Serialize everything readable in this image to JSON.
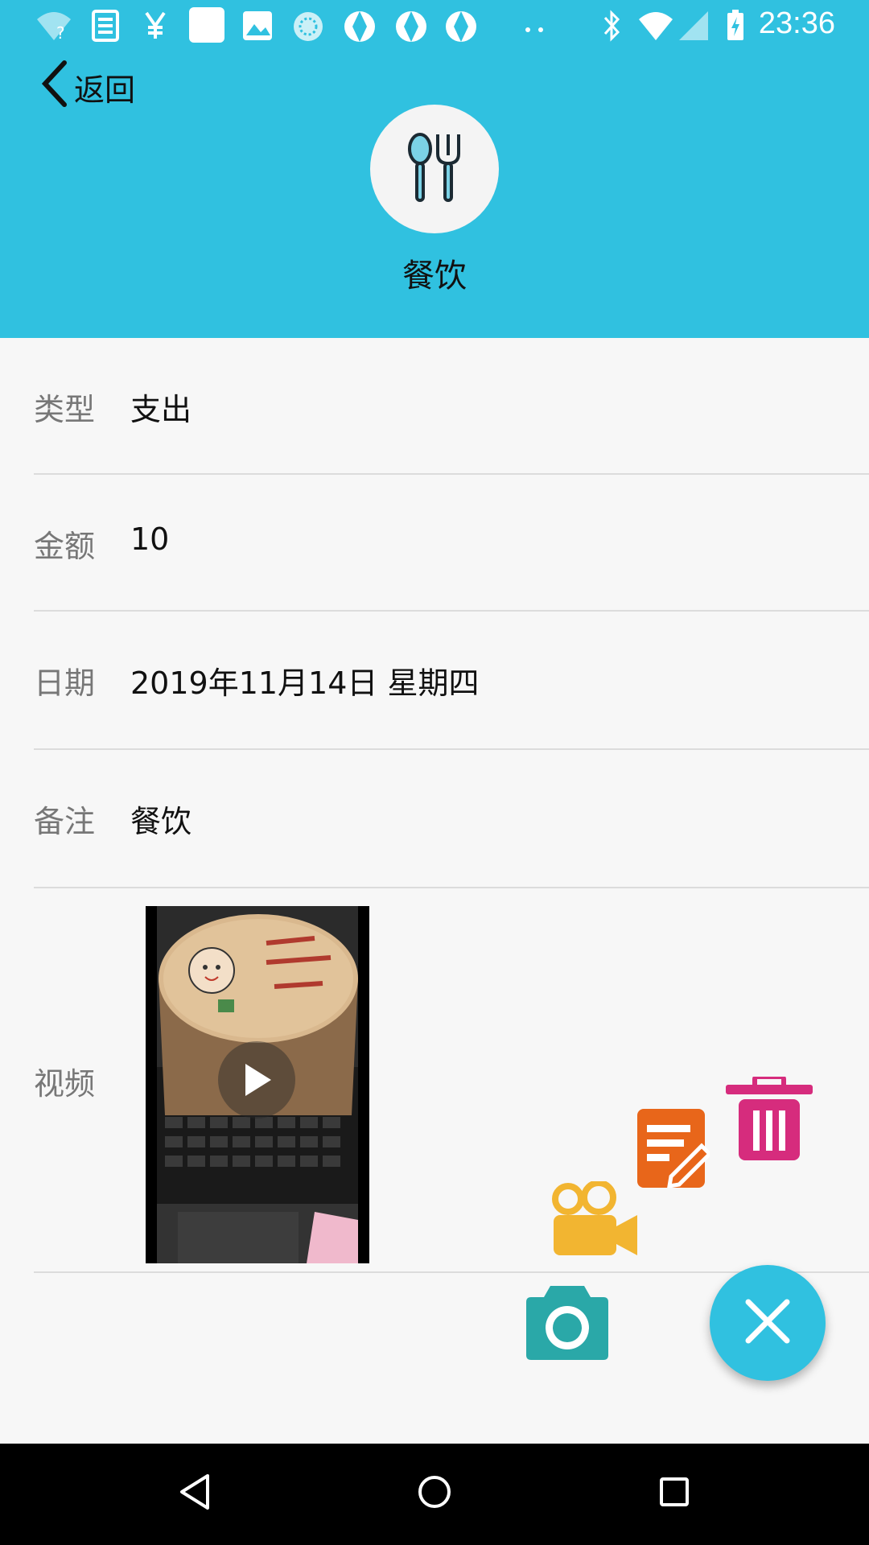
{
  "status_bar": {
    "time": "23:36",
    "left_icons": [
      "wifi-question-icon",
      "news-icon",
      "yen-icon",
      "square-icon",
      "image-icon",
      "loading-icon",
      "app-icon",
      "app-icon",
      "app-icon",
      "more-dots-icon"
    ],
    "right_icons": [
      "bluetooth-icon",
      "wifi-icon",
      "signal-icon",
      "battery-icon"
    ]
  },
  "header": {
    "back_label": "返回",
    "category_icon": "cutlery-icon",
    "category_title": "餐饮",
    "background_color": "#30c1e0"
  },
  "details": {
    "type": {
      "label": "类型",
      "value": "支出"
    },
    "amount": {
      "label": "金额",
      "value": "10"
    },
    "date": {
      "label": "日期",
      "value": "2019年11月14日 星期四"
    },
    "note": {
      "label": "备注",
      "value": "餐饮"
    },
    "video": {
      "label": "视频"
    }
  },
  "fab": {
    "actions": [
      "delete-icon",
      "edit-icon",
      "video-camera-icon",
      "camera-icon"
    ],
    "colors": {
      "delete": "#d62c7d",
      "edit": "#e8661a",
      "video": "#f2b531",
      "camera": "#2aa8a8",
      "main": "#30c1e0"
    },
    "main_icon": "close-icon"
  },
  "nav_bar": {
    "buttons": [
      "back-triangle-icon",
      "home-circle-icon",
      "recents-square-icon"
    ]
  }
}
